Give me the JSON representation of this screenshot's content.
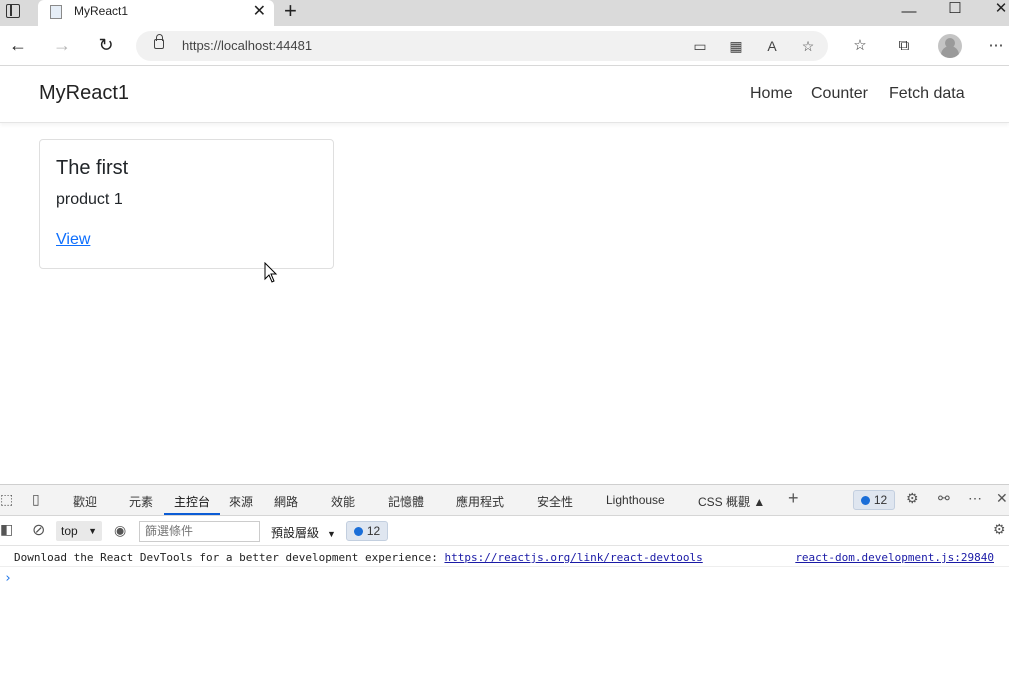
{
  "browser": {
    "tab_title": "MyReact1",
    "tab_close": "✕",
    "new_tab": "+",
    "url": "https://localhost:44481",
    "window": {
      "minimize": "—",
      "maximize": "☐",
      "close": "✕"
    },
    "nav": {
      "back": "←",
      "forward": "→",
      "refresh": "↻"
    }
  },
  "site": {
    "brand": "MyReact1",
    "nav_links": [
      "Home",
      "Counter",
      "Fetch data"
    ]
  },
  "card": {
    "title": "The first",
    "text": "product 1",
    "link": "View"
  },
  "devtools": {
    "tabs": [
      "歡迎",
      "元素",
      "主控台",
      "來源",
      "網路",
      "效能",
      "記憶體",
      "應用程式",
      "安全性",
      "Lighthouse",
      "CSS 概觀 ▲"
    ],
    "active_tab": "主控台",
    "issues_count": "12",
    "context": "top",
    "filter_placeholder": "篩選條件",
    "level": "預設層級",
    "console": {
      "message": "Download the React DevTools for a better development experience: ",
      "link": "https://reactjs.org/link/react-devtools",
      "source": "react-dom.development.js:29840"
    }
  }
}
